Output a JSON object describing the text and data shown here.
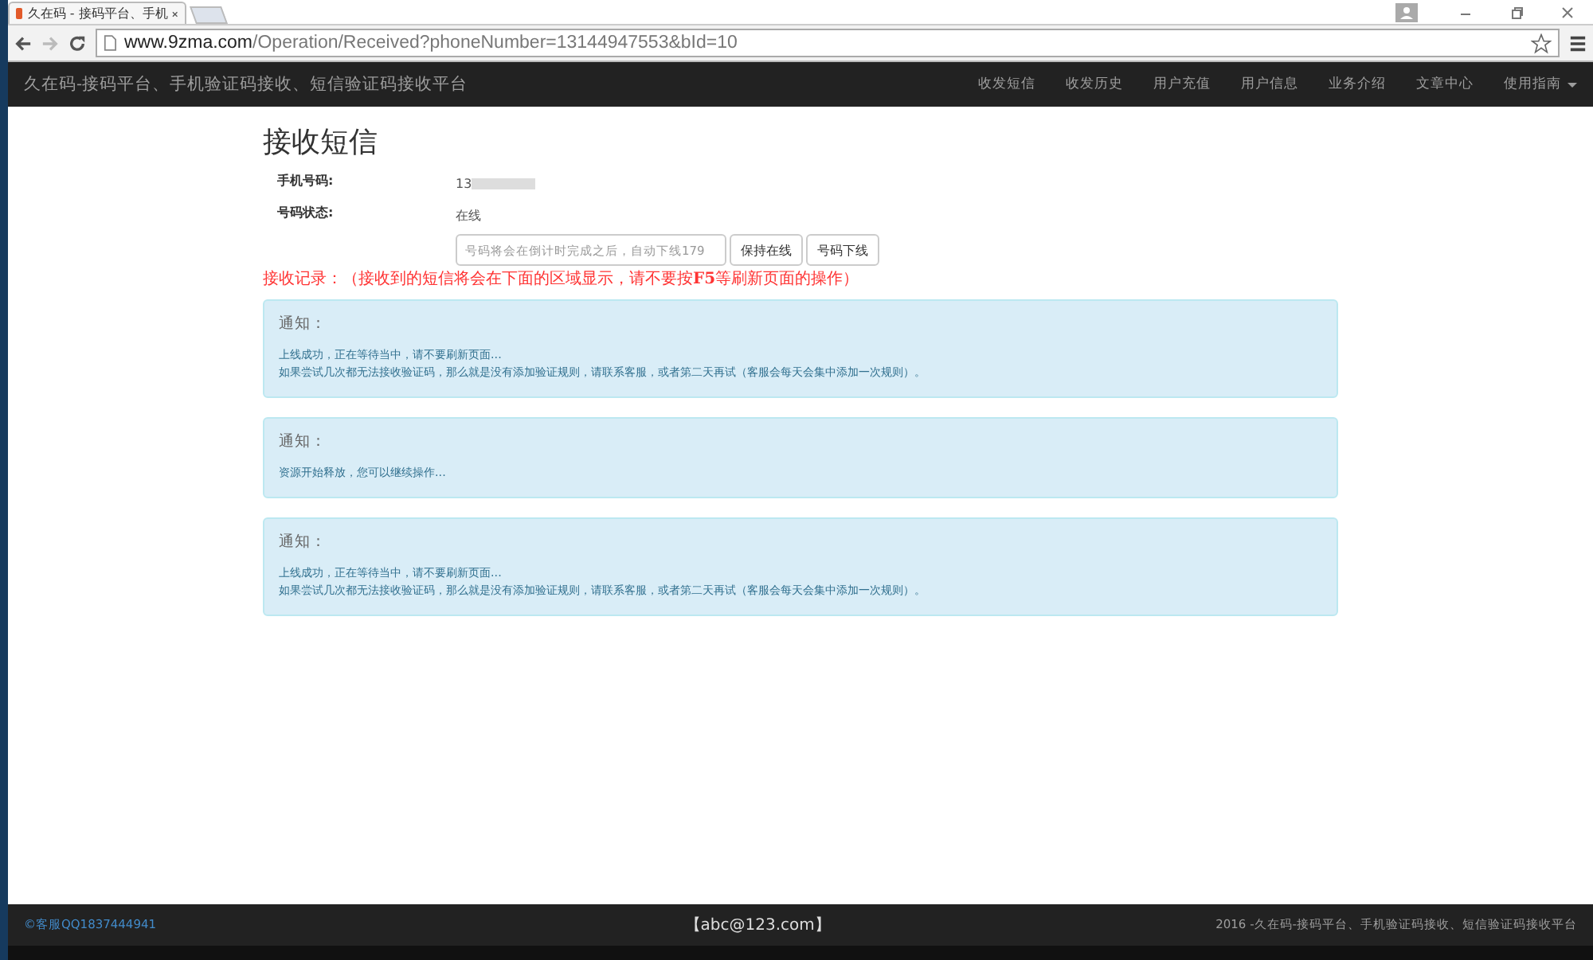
{
  "browser": {
    "tab_title": "久在码 - 接码平台、手机",
    "url_host": "www.9zma.com",
    "url_path": "/Operation/Received?phoneNumber=13144947553&bId=10"
  },
  "navbar": {
    "brand": "久在码-接码平台、手机验证码接收、短信验证码接收平台",
    "items": [
      {
        "label": "收发短信",
        "dropdown": false
      },
      {
        "label": "收发历史",
        "dropdown": false
      },
      {
        "label": "用户充值",
        "dropdown": false
      },
      {
        "label": "用户信息",
        "dropdown": false
      },
      {
        "label": "业务介绍",
        "dropdown": false
      },
      {
        "label": "文章中心",
        "dropdown": false
      },
      {
        "label": "使用指南",
        "dropdown": true
      }
    ]
  },
  "page": {
    "title": "接收短信",
    "fields": [
      {
        "label": "手机号码:",
        "value": "13",
        "redacted": true
      },
      {
        "label": "号码状态:",
        "value": "在线",
        "redacted": false
      }
    ],
    "countdown": {
      "placeholder": "号码将会在倒计时完成之后，自动下线179"
    },
    "buttons": [
      "保持在线",
      "号码下线"
    ],
    "record_note": "接收记录：（接收到的短信将会在下面的区域显示，请不要按**F5**等刷新页面的操作）",
    "alerts": [
      {
        "heading": "通知：",
        "lines": [
          "上线成功，正在等待当中，请不要刷新页面...",
          "如果尝试几次都无法接收验证码，那么就是没有添加验证规则，请联系客服，或者第二天再试（客服会每天会集中添加一次规则）。"
        ]
      },
      {
        "heading": "通知：",
        "lines": [
          "资源开始释放，您可以继续操作..."
        ]
      },
      {
        "heading": "通知：",
        "lines": [
          "上线成功，正在等待当中，请不要刷新页面...",
          "如果尝试几次都无法接收验证码，那么就是没有添加验证规则，请联系客服，或者第二天再试（客服会每天会集中添加一次规则）。"
        ]
      }
    ]
  },
  "footer": {
    "contact": "©客服QQ1837444941",
    "email": "【abc@123.com】",
    "copyright": "2016 -久在码-接码平台、手机验证码接收、短信验证码接收平台"
  }
}
